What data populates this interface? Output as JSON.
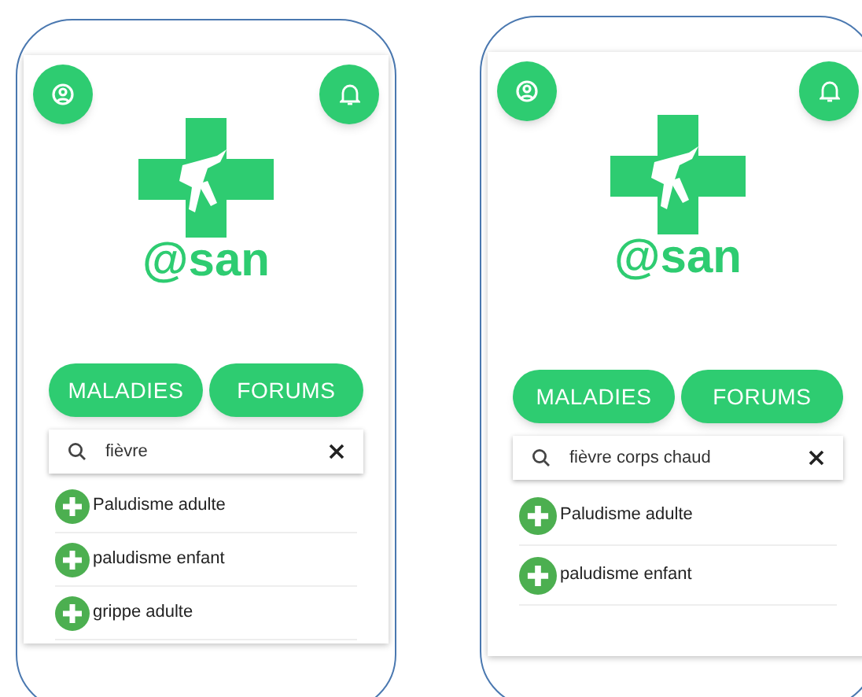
{
  "screens": [
    {
      "logo_text": "@san",
      "tabs": [
        {
          "label": "MALADIES"
        },
        {
          "label": "FORUMS"
        }
      ],
      "search": {
        "value": "fièvre"
      },
      "results": [
        {
          "label": "Paludisme adulte"
        },
        {
          "label": "paludisme enfant"
        },
        {
          "label": "grippe adulte"
        }
      ]
    },
    {
      "logo_text": "@san",
      "tabs": [
        {
          "label": "MALADIES"
        },
        {
          "label": "FORUMS"
        }
      ],
      "search": {
        "value": "fièvre corps chaud"
      },
      "results": [
        {
          "label": "Paludisme adulte"
        },
        {
          "label": "paludisme enfant"
        }
      ]
    }
  ]
}
